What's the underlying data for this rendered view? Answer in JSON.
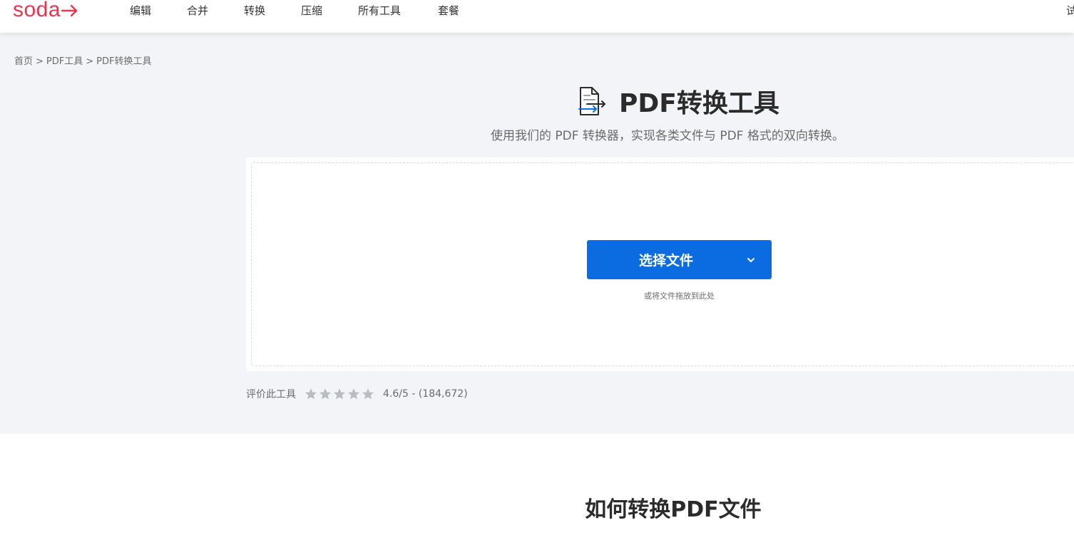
{
  "logo": {
    "text": "soda"
  },
  "nav": {
    "items": [
      {
        "label": "编辑"
      },
      {
        "label": "合并"
      },
      {
        "label": "转换"
      },
      {
        "label": "压缩"
      },
      {
        "label": "所有工具"
      },
      {
        "label": "套餐"
      }
    ],
    "right_label": "试"
  },
  "breadcrumb": {
    "items": [
      "首页",
      "PDF工具",
      "PDF转换工具"
    ],
    "separator": ">"
  },
  "hero": {
    "title": "PDF转换工具",
    "subtitle": "使用我们的 PDF 转换器，实现各类文件与 PDF 格式的双向转换。",
    "title_icon": "file-convert-icon"
  },
  "upload": {
    "button_label": "选择文件",
    "button_icon": "chevron-down-icon",
    "drop_hint": "或将文件拖放到此处"
  },
  "rating": {
    "label": "评价此工具",
    "stars": 5,
    "value_text": "4.6/5 - (184,672)"
  },
  "howto": {
    "title": "如何转换PDF文件"
  },
  "colors": {
    "brand": "#e8364d",
    "primary_button": "#0a6ce0",
    "hero_background": "#f3f4f7",
    "star": "#b9bcc3"
  }
}
